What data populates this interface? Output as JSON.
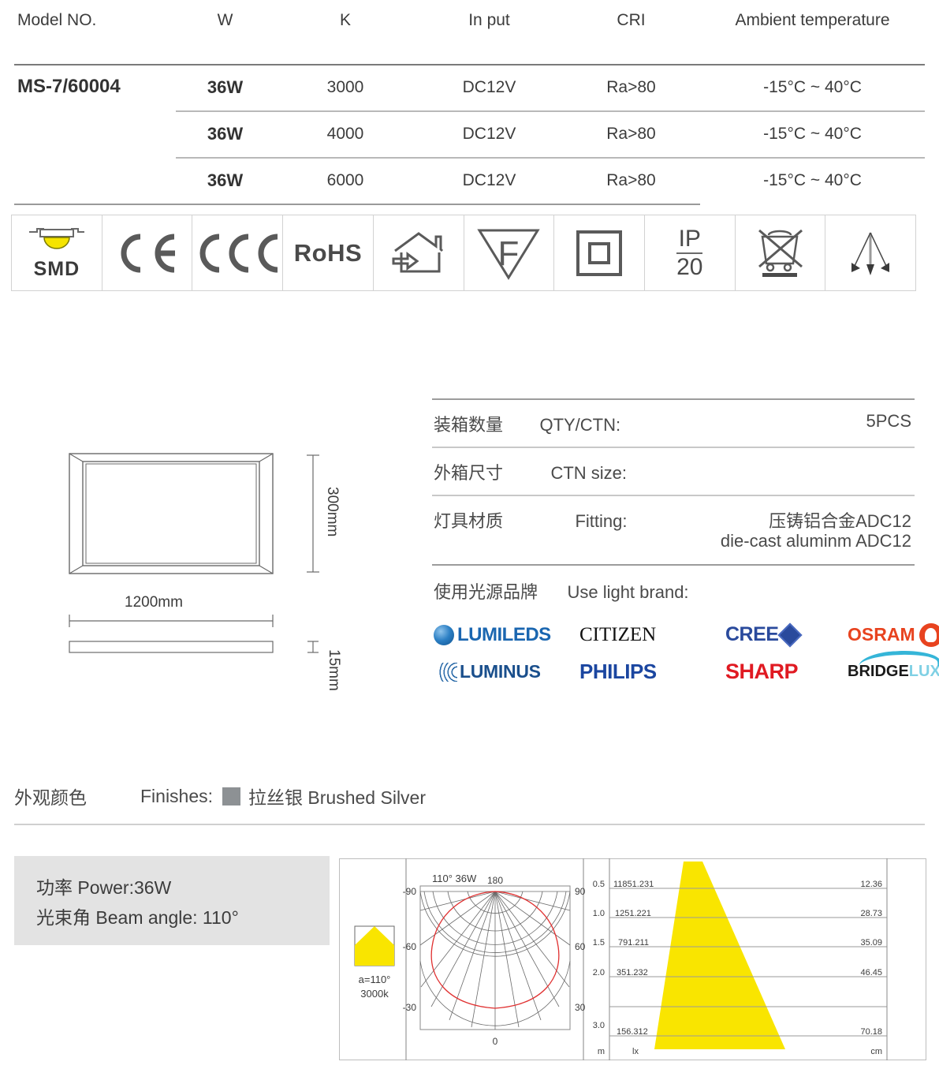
{
  "spec_table": {
    "headers": [
      "Model NO.",
      "W",
      "K",
      "In put",
      "CRI",
      "Ambient temperature"
    ],
    "model": "MS-7/60004",
    "rows": [
      {
        "w": "36W",
        "k": "3000",
        "input": "DC12V",
        "cri": "Ra>80",
        "ambient": "-15°C ~ 40°C"
      },
      {
        "w": "36W",
        "k": "4000",
        "input": "DC12V",
        "cri": "Ra>80",
        "ambient": "-15°C ~ 40°C"
      },
      {
        "w": "36W",
        "k": "6000",
        "input": "DC12V",
        "cri": "Ra>80",
        "ambient": "-15°C ~ 40°C"
      }
    ]
  },
  "certifications": [
    {
      "name": "smd",
      "label": "SMD"
    },
    {
      "name": "ce",
      "label": "CE"
    },
    {
      "name": "ccc",
      "label": "CCC"
    },
    {
      "name": "rohs",
      "label": "RoHS"
    },
    {
      "name": "indoor-use",
      "label": ""
    },
    {
      "name": "f-mark",
      "label": "F"
    },
    {
      "name": "class-two",
      "label": ""
    },
    {
      "name": "ip-rating",
      "label": "IP20",
      "ip_top": "IP",
      "ip_bottom": "20"
    },
    {
      "name": "weee",
      "label": ""
    },
    {
      "name": "beam-spread",
      "label": ""
    }
  ],
  "dimensions": {
    "width_label": "1200mm",
    "height_label": "300mm",
    "thickness_label": "15mm"
  },
  "packing": {
    "qty": {
      "cn": "装箱数量",
      "en": "QTY/CTN:",
      "value": "5PCS"
    },
    "ctn_size": {
      "cn": "外箱尺寸",
      "en": "CTN size:",
      "value": ""
    },
    "fitting": {
      "cn": "灯具材质",
      "en": "Fitting:",
      "value_cn": "压铸铝合金ADC12",
      "value_en": "die-cast aluminm ADC12"
    },
    "brands_title": {
      "cn": "使用光源品牌",
      "en": "Use light brand:"
    },
    "brands": [
      {
        "name": "lumileds",
        "text": "LUMILEDS"
      },
      {
        "name": "citizen",
        "text": "CITIZEN"
      },
      {
        "name": "cree",
        "text": "CREE"
      },
      {
        "name": "osram",
        "text": "OSRAM"
      },
      {
        "name": "luminus",
        "text": "LUMINUS"
      },
      {
        "name": "philips",
        "text": "PHILIPS"
      },
      {
        "name": "sharp",
        "text": "SHARP"
      },
      {
        "name": "bridgelux",
        "text_dark": "BRIDGE",
        "text_light": "LUX"
      }
    ]
  },
  "finishes": {
    "cn": "外观颜色",
    "en": "Finishes:",
    "color_hex": "#8d9194",
    "value": "拉丝银 Brushed Silver"
  },
  "photometric": {
    "power_line": "功率 Power:36W",
    "beam_line": "光束角 Beam angle: 110°",
    "beam_icon": {
      "angle": "a=110°",
      "cct": "3000k"
    },
    "polar": {
      "title": "110°  36W",
      "top_label": "180",
      "bottom_label": "0",
      "left_ticks": [
        "-90",
        "-60",
        "-30"
      ],
      "right_ticks": [
        "90",
        "60",
        "30"
      ],
      "curve_color": "#e03030"
    },
    "cone": {
      "unit_left": "m",
      "unit_mid": "lx",
      "unit_right": "cm",
      "rows": [
        {
          "distance": "0.5",
          "lux": "11851.231",
          "diameter": "12.36"
        },
        {
          "distance": "1.0",
          "lux": "1251.221",
          "diameter": "28.73"
        },
        {
          "distance": "1.5",
          "lux": "791.211",
          "diameter": "35.09"
        },
        {
          "distance": "2.0",
          "lux": "351.232",
          "diameter": "46.45"
        },
        {
          "distance": "3.0",
          "lux": "156.312",
          "diameter": "70.18"
        }
      ],
      "beam_color": "#f9e500"
    }
  }
}
